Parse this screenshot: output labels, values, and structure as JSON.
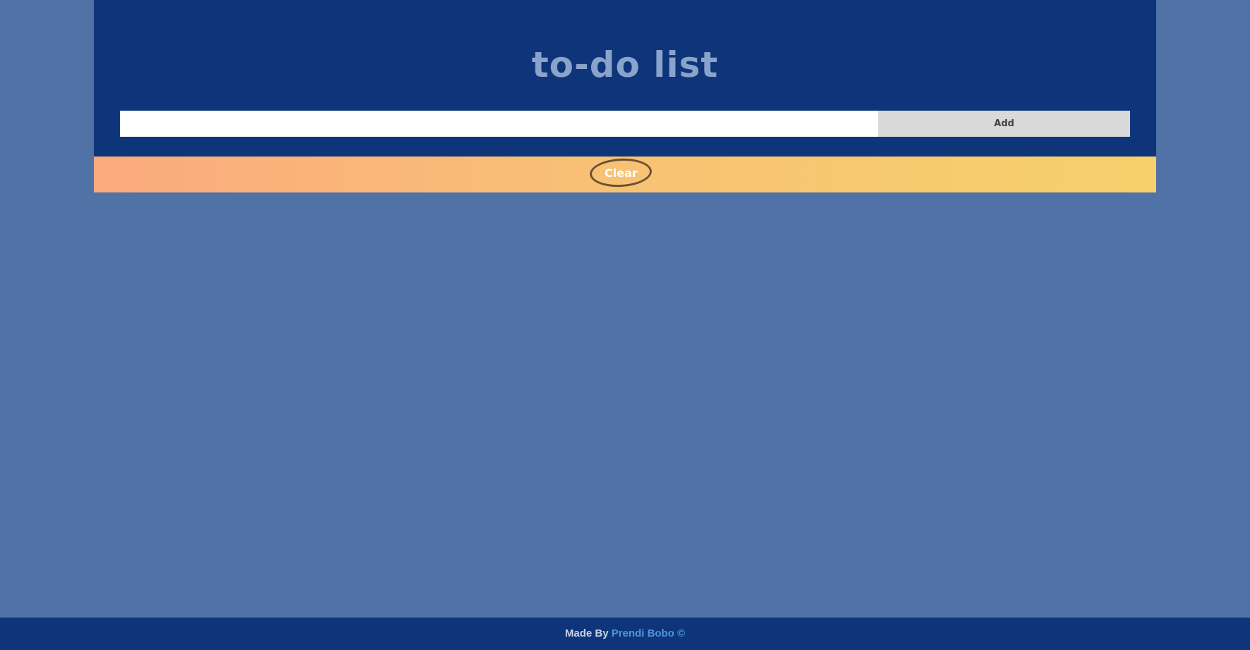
{
  "header": {
    "title": "to-do list"
  },
  "todo_input": {
    "value": "",
    "placeholder": ""
  },
  "add_button": {
    "label": "Add"
  },
  "clear_button": {
    "label": "Clear"
  },
  "footer": {
    "prefix": "Made By",
    "author": "Prendi Bobo",
    "symbol": "©"
  },
  "colors": {
    "page_background": "#5072a7",
    "header_background": "#0e357a",
    "title": "#8aa3cc",
    "clear_gradient_start": "#fba97e",
    "clear_gradient_end": "#f6d06b",
    "author_link": "#4f94e0"
  }
}
